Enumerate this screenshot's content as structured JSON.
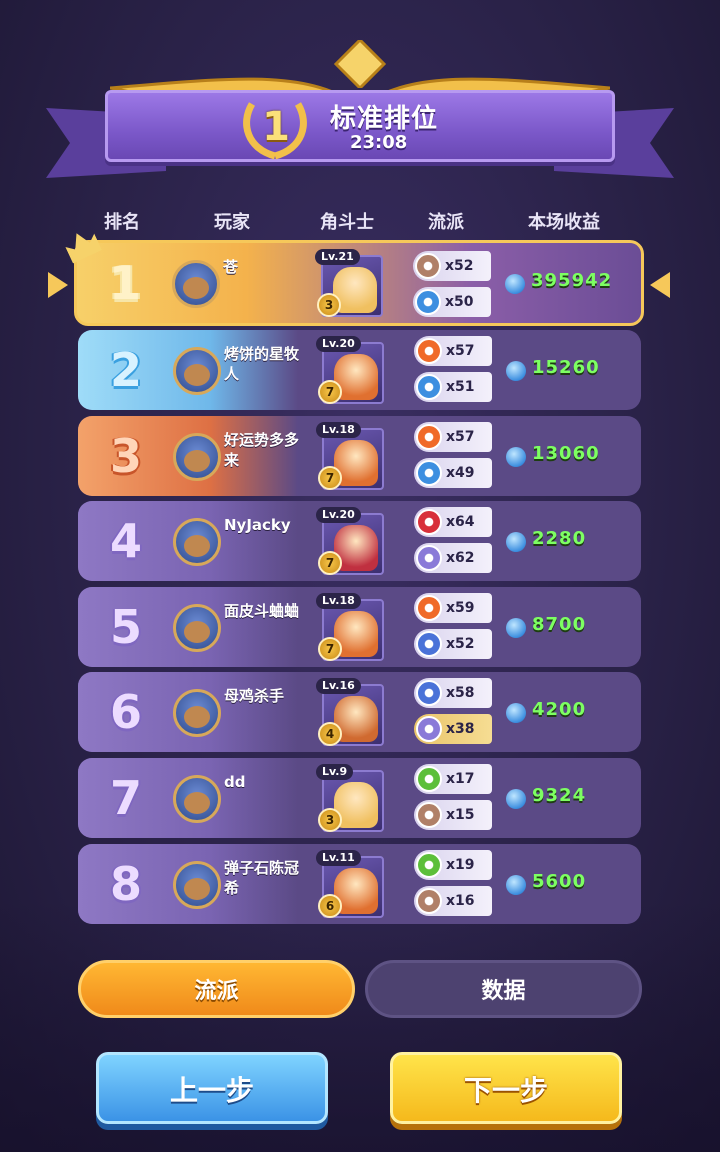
{
  "header": {
    "rank": "1",
    "mode": "标准排位",
    "time": "23:08"
  },
  "columns": [
    "排名",
    "玩家",
    "角斗士",
    "流派",
    "本场收益"
  ],
  "rows": [
    {
      "rank": "1",
      "name": "苍",
      "level": "Lv.21",
      "star": "3",
      "schools": [
        {
          "icon": "shield-icon",
          "count": "x52"
        },
        {
          "icon": "water-drop-icon",
          "count": "x50"
        }
      ],
      "income": "395942"
    },
    {
      "rank": "2",
      "name": "烤饼的星牧人",
      "level": "Lv.20",
      "star": "7",
      "schools": [
        {
          "icon": "fire-icon",
          "count": "x57"
        },
        {
          "icon": "water-drop-icon",
          "count": "x51"
        }
      ],
      "income": "15260"
    },
    {
      "rank": "3",
      "name": "好运势多多来",
      "level": "Lv.18",
      "star": "7",
      "schools": [
        {
          "icon": "fire-icon",
          "count": "x57"
        },
        {
          "icon": "water-drop-icon",
          "count": "x49"
        }
      ],
      "income": "13060"
    },
    {
      "rank": "4",
      "name": "NyJacky",
      "level": "Lv.20",
      "star": "7",
      "schools": [
        {
          "icon": "flame-red-icon",
          "count": "x64"
        },
        {
          "icon": "sword-icon",
          "count": "x62"
        }
      ],
      "income": "2280"
    },
    {
      "rank": "5",
      "name": "面皮斗蛐蛐",
      "level": "Lv.18",
      "star": "7",
      "schools": [
        {
          "icon": "fire-icon",
          "count": "x59"
        },
        {
          "icon": "boot-icon",
          "count": "x52"
        }
      ],
      "income": "8700"
    },
    {
      "rank": "6",
      "name": "母鸡杀手",
      "level": "Lv.16",
      "star": "4",
      "schools": [
        {
          "icon": "boot-icon",
          "count": "x58"
        },
        {
          "icon": "sword-icon",
          "count": "x38"
        }
      ],
      "income": "4200"
    },
    {
      "rank": "7",
      "name": "dd",
      "level": "Lv.9",
      "star": "3",
      "schools": [
        {
          "icon": "heal-cross-icon",
          "count": "x17"
        },
        {
          "icon": "shield-icon",
          "count": "x15"
        }
      ],
      "income": "9324"
    },
    {
      "rank": "8",
      "name": "弹子石陈冠希",
      "level": "Lv.11",
      "star": "6",
      "schools": [
        {
          "icon": "heal-cross-icon",
          "count": "x19"
        },
        {
          "icon": "shield-icon",
          "count": "x16"
        }
      ],
      "income": "5600"
    }
  ],
  "tabs": {
    "school": "流派",
    "data": "数据"
  },
  "buttons": {
    "prev": "上一步",
    "next": "下一步"
  },
  "colors": {
    "income_green": "#7dff62",
    "gold": "#f6c85a",
    "rank2_blue": "#8fd4f5",
    "rank3_orange": "#f08c5a",
    "row_purple": "#5b4a86"
  }
}
